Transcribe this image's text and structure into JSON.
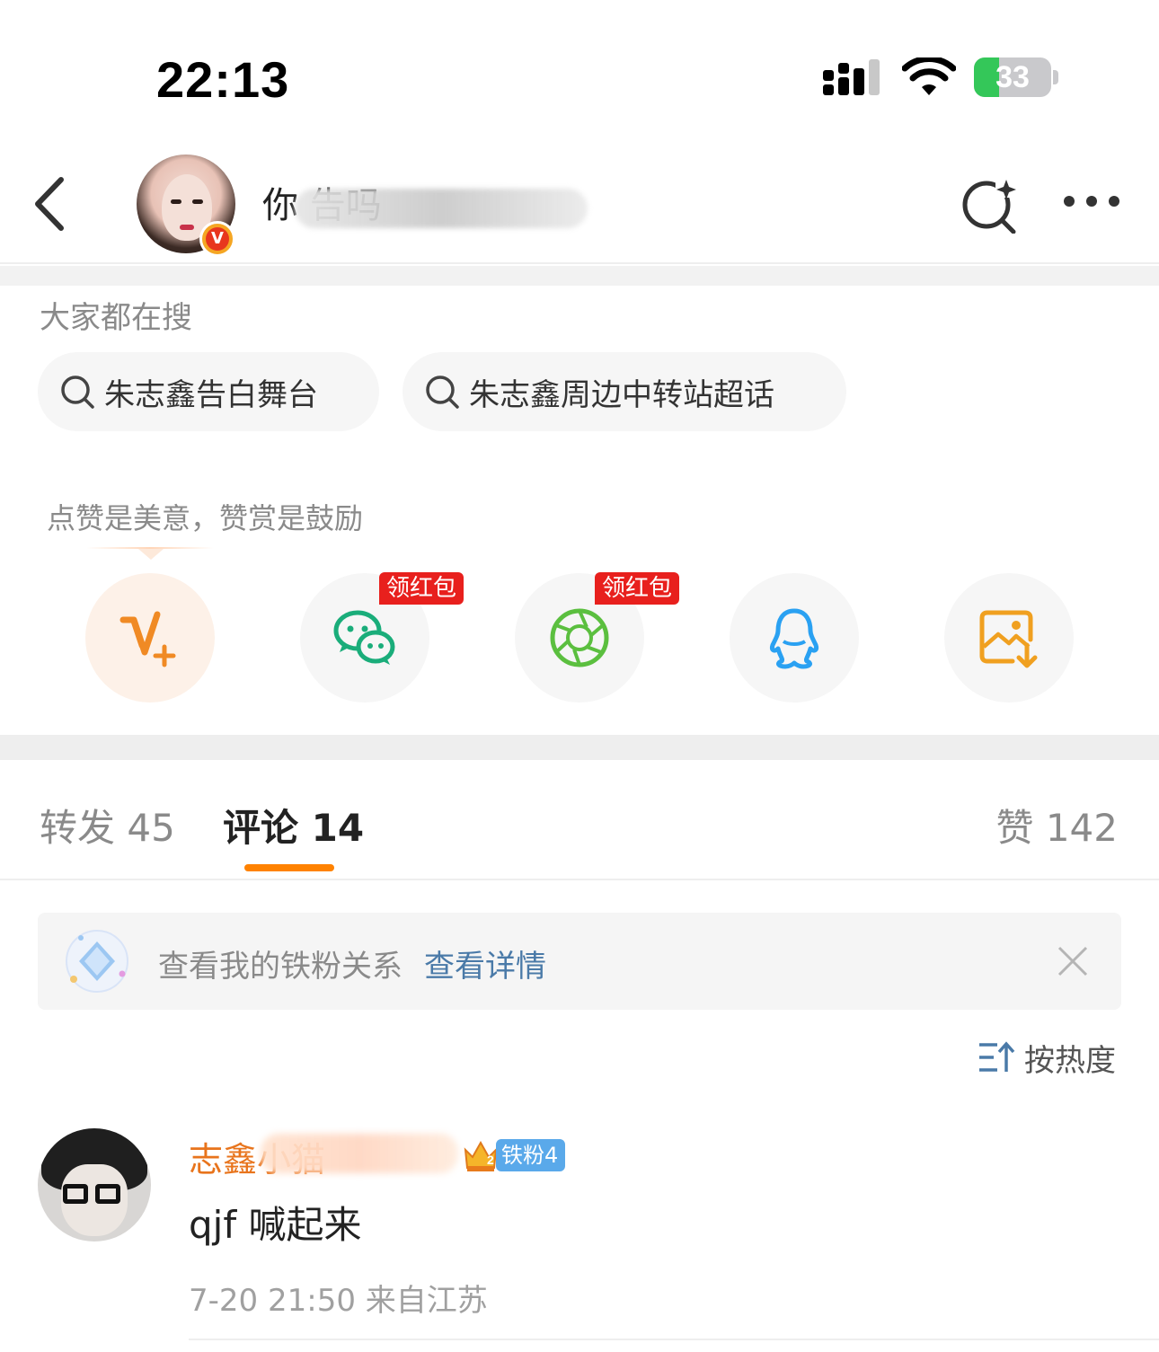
{
  "status_bar": {
    "time": "22:13",
    "battery": "33",
    "battery_level": 0.33
  },
  "header": {
    "title": "你           告吗",
    "icons": [
      "back-icon",
      "search-spark-icon",
      "more-icon"
    ]
  },
  "hot_search": {
    "title": "大家都在搜",
    "chips": [
      {
        "label": "朱志鑫告白舞台"
      },
      {
        "label": "朱志鑫周边中转站超话"
      }
    ]
  },
  "reward": {
    "tip": "点赞是美意，赞赏是鼓励"
  },
  "share": {
    "red_tag": "领红包",
    "items": [
      "v-plus-icon",
      "wechat-icon",
      "moments-icon",
      "qq-icon",
      "save-image-icon"
    ]
  },
  "tabs": {
    "repost": "转发 45",
    "comments": "评论 14",
    "likes": "赞 142"
  },
  "fans_banner": {
    "text": "查看我的铁粉关系",
    "link": "查看详情"
  },
  "sort": {
    "label": "按热度"
  },
  "comments": [
    {
      "name": "志鑫小猫",
      "fan_badge": "铁粉4",
      "crown_level": "2",
      "text": "qjf 喊起来",
      "meta": "7-20 21:50  来自江苏"
    }
  ],
  "colors": {
    "accent": "#ff8200",
    "link": "#4a7aa8",
    "commenter": "#e8741c",
    "red_tag": "#e8201d",
    "fan_badge": "#5aa9ea"
  }
}
